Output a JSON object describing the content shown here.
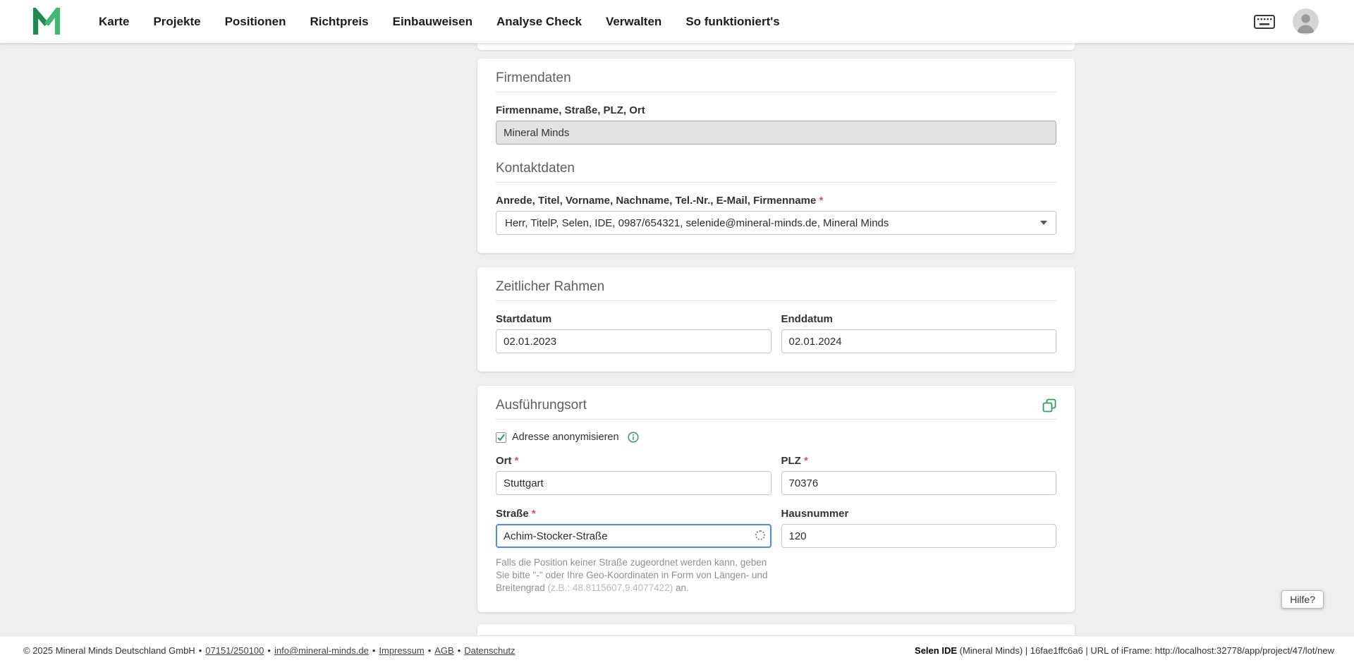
{
  "ui": {
    "required_mark": "*",
    "separator": "•"
  },
  "colors": {
    "accent_green": "#2aa05a",
    "focus_blue": "#4a90e2",
    "required_red": "#d9534f"
  },
  "navbar": {
    "items": [
      "Karte",
      "Projekte",
      "Positionen",
      "Richtpreis",
      "Einbauweisen",
      "Analyse Check",
      "Verwalten",
      "So funktioniert's"
    ]
  },
  "company": {
    "title": "Firmendaten",
    "company_label": "Firmenname, Straße, PLZ, Ort",
    "company_value": "Mineral Minds",
    "contact_title": "Kontaktdaten",
    "contact_label": "Anrede, Titel, Vorname, Nachname, Tel.-Nr., E-Mail, Firmenname",
    "contact_value": "Herr, TitelP, Selen, IDE, 0987/654321, selenide@mineral-minds.de, Mineral Minds"
  },
  "timeframe": {
    "title": "Zeitlicher Rahmen",
    "start_label": "Startdatum",
    "start_value": "02.01.2023",
    "end_label": "Enddatum",
    "end_value": "02.01.2024"
  },
  "location": {
    "title": "Ausführungsort",
    "anonymize_label": "Adresse anonymisieren",
    "ort_label": "Ort",
    "ort_value": "Stuttgart",
    "plz_label": "PLZ",
    "plz_value": "70376",
    "strasse_label": "Straße",
    "strasse_value": "Achim-Stocker-Straße",
    "hausnummer_label": "Hausnummer",
    "hausnummer_value": "120",
    "helper_text": "Falls die Position keiner Straße zugeordnet werden kann, geben Sie bitte \"-\" oder Ihre Geo-Koordinaten in Form von Längen- und Breitengrad",
    "helper_example": "(z.B.: 48.8115607,9.4077422)",
    "helper_suffix": "an."
  },
  "help_button": {
    "label": "Hilfe?"
  },
  "footer": {
    "copyright": "© 2025 Mineral Minds Deutschland GmbH",
    "links": [
      "07151/250100",
      "info@mineral-minds.de",
      "Impressum",
      "AGB",
      "Datenschutz"
    ],
    "right_bold": "Selen IDE",
    "right_rest": "(Mineral Minds) | 16fae1ffc6a6 | URL of iFrame: http://localhost:32778/app/project/47/lot/new"
  }
}
